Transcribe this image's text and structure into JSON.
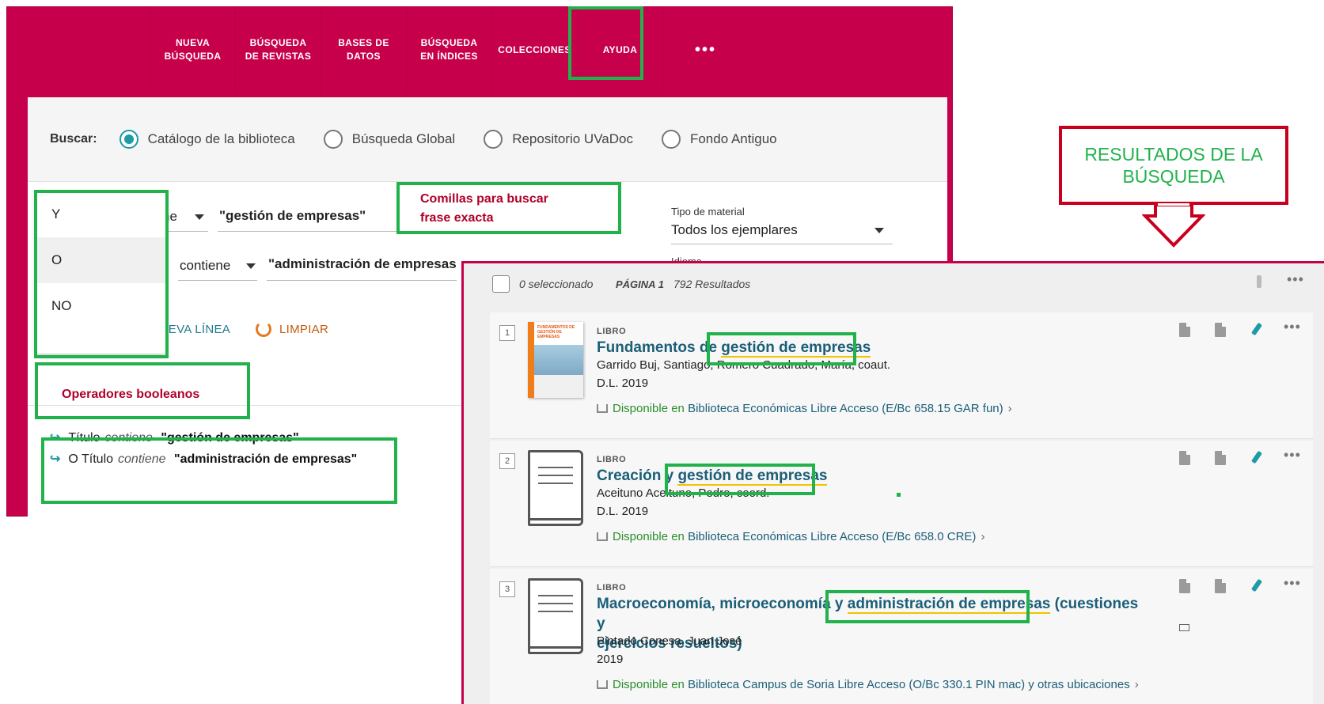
{
  "nav": {
    "items": [
      "NUEVA\nBÚSQUEDA",
      "BÚSQUEDA\nDE REVISTAS",
      "BASES DE\nDATOS",
      "BÚSQUEDA\nEN ÍNDICES",
      "COLECCIONES",
      "AYUDA"
    ],
    "more": "•••"
  },
  "scope": {
    "label": "Buscar:",
    "options": [
      "Catálogo de la biblioteca",
      "Búsqueda Global",
      "Repositorio UVaDoc",
      "Fondo Antiguo"
    ],
    "selected": "Catálogo de la biblioteca"
  },
  "query": {
    "row1_operator_partial": "ne",
    "row1_value": "\"gestión de empresas\"",
    "row2_operator": "contiene",
    "row2_value": "\"administración de empresas",
    "material_label": "Tipo de material",
    "material_value": "Todos los ejemplares",
    "language_label": "Idioma",
    "add_line_partial": "JEVA LÍNEA",
    "clear_label": "LIMPIAR"
  },
  "boolean_dropdown": {
    "options": [
      "Y",
      "O",
      "NO"
    ]
  },
  "summary": {
    "line1": {
      "field": "Título",
      "op": "contiene",
      "value": "\"gestión de empresas\""
    },
    "line2": {
      "prefix": "O",
      "field": "Título",
      "op": "contiene",
      "value": "\"administración de empresas\""
    }
  },
  "annotations": {
    "quotes_note": "Comillas para buscar\nfrase exacta",
    "boolean_note": "Operadores booleanos",
    "results_callout": "RESULTADOS DE LA\nBÚSQUEDA"
  },
  "results": {
    "selected_text": "0 seleccionado",
    "page_text": "PÁGINA 1",
    "count_text": "792 Resultados",
    "items": [
      {
        "index": "1",
        "type": "LIBRO",
        "title_pre": "Fundamentos de ",
        "title_hl": "gestión de empresas",
        "title_post": "",
        "authors": "Garrido Buj, Santiago; Romero Cuadrado, María, coaut.",
        "year": "D.L. 2019",
        "avail_prefix": "Disponible en",
        "avail_location": "Biblioteca Económicas",
        "avail_detail": "Libre Acceso (E/Bc 658.15 GAR fun)",
        "cover_text": "FUNDAMENTOS DE GESTIÓN DE EMPRESAS"
      },
      {
        "index": "2",
        "type": "LIBRO",
        "title_pre": "Creación y ",
        "title_hl": "gestión de empresas",
        "title_post": "",
        "authors": "Aceituno Aceituno, Pedro, coord.",
        "year": "D.L. 2019",
        "avail_prefix": "Disponible en",
        "avail_location": "Biblioteca Económicas",
        "avail_detail": "Libre Acceso (E/Bc 658.0 CRE)"
      },
      {
        "index": "3",
        "type": "LIBRO",
        "title_pre": "Macroeconomía, microeconomía y ",
        "title_hl": "administración de empresas",
        "title_post": " (cuestiones y",
        "title_line2": "ejercicios resueltos)",
        "authors": "Pintado Conesa, Juan José",
        "year": "2019",
        "avail_prefix": "Disponible en",
        "avail_location": "Biblioteca Campus de Soria",
        "avail_detail": "Libre Acceso (O/Bc 330.1 PIN mac) y otras ubicaciones"
      }
    ]
  }
}
